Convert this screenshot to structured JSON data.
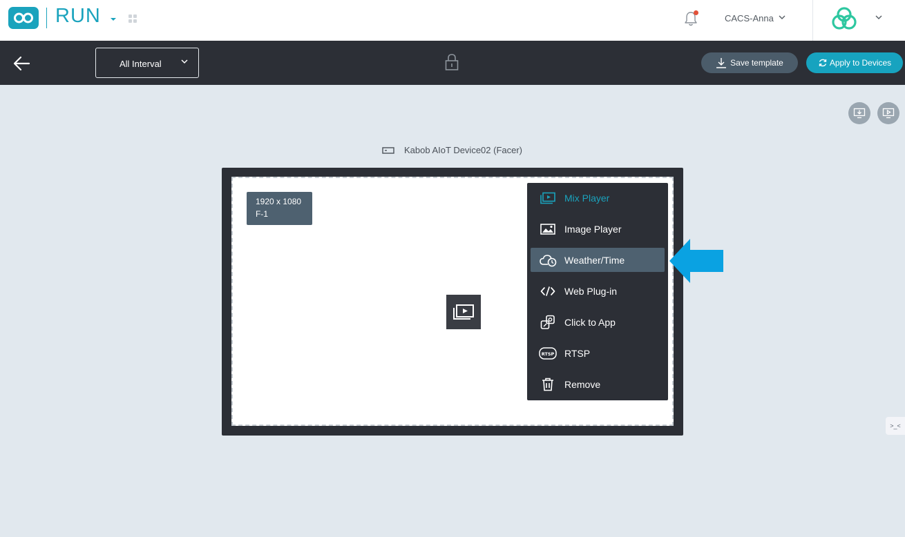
{
  "header": {
    "app_name": "RUN",
    "user_name": "CACS-Anna",
    "notification_dot_color": "#e2523a"
  },
  "toolbar": {
    "interval_value": "All Interval",
    "save_label": "Save template",
    "apply_label": "Apply to Devices"
  },
  "canvas": {
    "device_name": "Kabob AIoT Device02 (Facer)",
    "resolution": "1920 x 1080",
    "frame_id": "F-1"
  },
  "context_menu": {
    "items": [
      {
        "label": "Mix Player",
        "icon": "mix-player-icon",
        "state": "active"
      },
      {
        "label": "Image Player",
        "icon": "image-icon"
      },
      {
        "label": "Weather/Time",
        "icon": "weather-time-icon",
        "state": "hover"
      },
      {
        "label": "Web Plug-in",
        "icon": "code-icon"
      },
      {
        "label": "Click to App",
        "icon": "click-app-icon"
      },
      {
        "label": "RTSP",
        "icon": "rtsp-icon"
      },
      {
        "label": "Remove",
        "icon": "trash-icon"
      }
    ]
  },
  "side_tab": {
    "label": ">_<"
  },
  "colors": {
    "accent": "#1aa3bd",
    "toolbar_bg": "#2c2f36",
    "canvas_bg": "#e1e8ee",
    "annotation_arrow": "#0aa2e2"
  }
}
